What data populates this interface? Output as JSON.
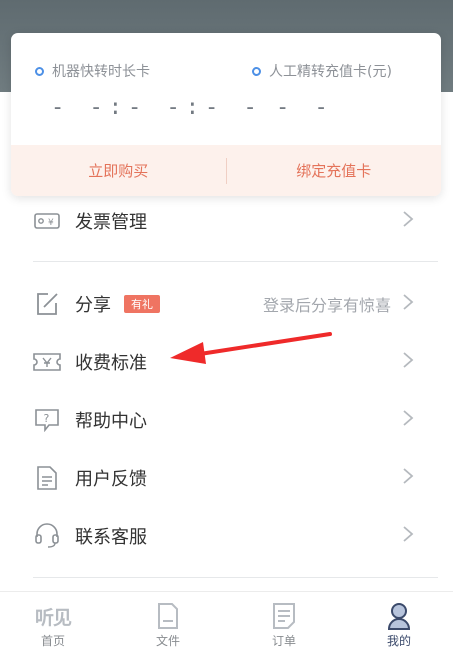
{
  "card": {
    "left_label": "机器快转时长卡",
    "left_value": "- -:- -:- -",
    "right_label": "人工精转充值卡(元)",
    "right_value": "- -",
    "buy_label": "立即购买",
    "bind_label": "绑定充值卡",
    "accent_color": "#e4735a"
  },
  "menu": {
    "items": [
      {
        "label": "发票管理",
        "icon": "invoice-icon"
      },
      {
        "label": "分享",
        "icon": "share-icon",
        "badge": "有礼",
        "hint": "登录后分享有惊喜"
      },
      {
        "label": "收费标准",
        "icon": "ticket-icon"
      },
      {
        "label": "帮助中心",
        "icon": "help-icon"
      },
      {
        "label": "用户反馈",
        "icon": "feedback-icon"
      },
      {
        "label": "联系客服",
        "icon": "headset-icon"
      }
    ]
  },
  "tabbar": {
    "logo_text": "听见",
    "tabs": [
      {
        "label": "首页",
        "icon": "home-logo-icon"
      },
      {
        "label": "文件",
        "icon": "file-icon"
      },
      {
        "label": "订单",
        "icon": "order-icon"
      },
      {
        "label": "我的",
        "icon": "profile-icon",
        "active": true
      }
    ]
  }
}
